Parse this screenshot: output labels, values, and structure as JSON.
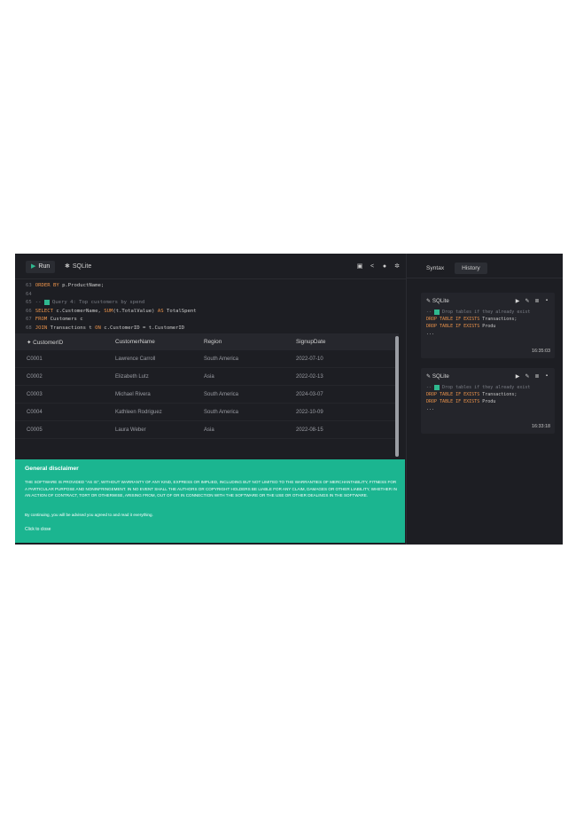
{
  "toolbar": {
    "run_label": "Run",
    "db_label": "SQLite",
    "icons": [
      "save-icon",
      "share-icon",
      "user-icon",
      "settings-icon"
    ]
  },
  "editor": {
    "lines": [
      {
        "n": "63",
        "parts": [
          {
            "t": "ORDER BY ",
            "c": "kw"
          },
          {
            "t": "p.ProductName;",
            "c": "tx"
          }
        ]
      },
      {
        "n": "64",
        "parts": [
          {
            "t": "",
            "c": "tx"
          }
        ]
      },
      {
        "n": "65",
        "parts": [
          {
            "t": "-- ",
            "c": "cm"
          },
          {
            "t": "",
            "c": "chk"
          },
          {
            "t": "Query 4: Top customers by spend",
            "c": "cm"
          }
        ]
      },
      {
        "n": "66",
        "parts": [
          {
            "t": "SELECT ",
            "c": "kw"
          },
          {
            "t": "c.CustomerName, ",
            "c": "tx"
          },
          {
            "t": "SUM",
            "c": "kw"
          },
          {
            "t": "(t.TotalValue) ",
            "c": "tx"
          },
          {
            "t": "AS ",
            "c": "kw"
          },
          {
            "t": "TotalSpent",
            "c": "tx"
          }
        ]
      },
      {
        "n": "67",
        "parts": [
          {
            "t": "FROM ",
            "c": "kw"
          },
          {
            "t": "Customers c",
            "c": "tx"
          }
        ]
      },
      {
        "n": "68",
        "parts": [
          {
            "t": "JOIN ",
            "c": "kw"
          },
          {
            "t": "Transactions t ",
            "c": "tx"
          },
          {
            "t": "ON ",
            "c": "kw"
          },
          {
            "t": "c.CustomerID = t.CustomerID",
            "c": "tx"
          }
        ]
      }
    ]
  },
  "table": {
    "headers": [
      "CustomerID",
      "CustomerName",
      "Region",
      "SignupDate"
    ],
    "rows": [
      [
        "C0001",
        "Lawrence Carroll",
        "South America",
        "2022-07-10"
      ],
      [
        "C0002",
        "Elizabeth Lutz",
        "Asia",
        "2022-02-13"
      ],
      [
        "C0003",
        "Michael Rivera",
        "South America",
        "2024-03-07"
      ],
      [
        "C0004",
        "Kathleen Rodriguez",
        "South America",
        "2022-10-09"
      ],
      [
        "C0005",
        "Laura Weber",
        "Asia",
        "2022-08-15"
      ]
    ]
  },
  "disclaimer": {
    "title": "General disclaimer",
    "body": "THE SOFTWARE IS PROVIDED \"AS IS\", WITHOUT WARRANTY OF ANY KIND, EXPRESS OR IMPLIED, INCLUDING BUT NOT LIMITED TO THE WARRANTIES OF MERCHANTABILITY, FITNESS FOR A PARTICULAR PURPOSE AND NONINFRINGEMENT. IN NO EVENT SHALL THE AUTHORS OR COPYRIGHT HOLDERS BE LIABLE FOR ANY CLAIM, DAMAGES OR OTHER LIABILITY, WHETHER IN AN ACTION OF CONTRACT, TORT OR OTHERWISE, ARISING FROM, OUT OF OR IN CONNECTION WITH THE SOFTWARE OR THE USE OR OTHER DEALINGS IN THE SOFTWARE.",
    "note": "By continuing, you will be advised you agreed to and read it everything.",
    "close_label": "Click to close"
  },
  "side": {
    "tabs": [
      "Syntax",
      "History"
    ],
    "active_tab": "History",
    "history": [
      {
        "db": "SQLite",
        "lines": [
          [
            {
              "t": "-- ",
              "c": "cm"
            },
            {
              "t": "",
              "c": "chk"
            },
            {
              "t": "Drop tables if they already exist",
              "c": "cm"
            }
          ],
          [
            {
              "t": "DROP TABLE IF EXISTS ",
              "c": "kw"
            },
            {
              "t": "Transactions;",
              "c": "tx"
            }
          ],
          [
            {
              "t": "DROP TABLE IF EXISTS ",
              "c": "kw"
            },
            {
              "t": "Produ",
              "c": "tx"
            }
          ],
          [
            {
              "t": "...",
              "c": "tx"
            }
          ]
        ],
        "time": "16:35:03"
      },
      {
        "db": "SQLite",
        "lines": [
          [
            {
              "t": "-- ",
              "c": "cm"
            },
            {
              "t": "",
              "c": "chk"
            },
            {
              "t": "Drop tables if they already exist",
              "c": "cm"
            }
          ],
          [
            {
              "t": "DROP TABLE IF EXISTS ",
              "c": "kw"
            },
            {
              "t": "Transactions;",
              "c": "tx"
            }
          ],
          [
            {
              "t": "DROP TABLE IF EXISTS ",
              "c": "kw"
            },
            {
              "t": "Produ",
              "c": "tx"
            }
          ],
          [
            {
              "t": "...",
              "c": "tx"
            }
          ]
        ],
        "time": "16:33:18"
      }
    ]
  },
  "colors": {
    "background": "#1d1e23",
    "accent": "#1bb590",
    "keyword": "#e8914a"
  }
}
